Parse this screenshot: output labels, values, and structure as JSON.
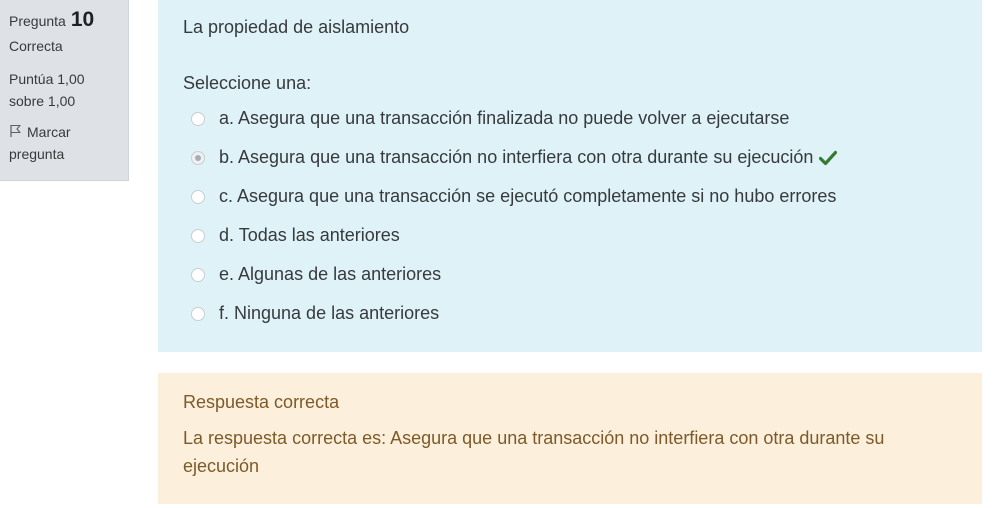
{
  "info": {
    "question_label": "Pregunta",
    "question_number": "10",
    "state": "Correcta",
    "grade_line1": "Puntúa 1,00",
    "grade_line2": "sobre 1,00",
    "flag_line1": "Marcar",
    "flag_line2": "pregunta",
    "flag_icon": "flag-icon"
  },
  "question": {
    "text": "La propiedad de aislamiento",
    "prompt": "Seleccione una:",
    "options": [
      {
        "label": "a. Asegura que una transacción finalizada no puede volver a ejecutarse",
        "selected": false
      },
      {
        "label": "b. Asegura que una transacción no interfiera con otra durante su ejecución",
        "selected": true,
        "correct_icon": "check-icon"
      },
      {
        "label": "c. Asegura que una transacción se ejecutó completamente si no hubo errores",
        "selected": false
      },
      {
        "label": "d. Todas las anteriores",
        "selected": false
      },
      {
        "label": "e. Algunas de las anteriores",
        "selected": false
      },
      {
        "label": "f. Ninguna de las anteriores",
        "selected": false
      }
    ]
  },
  "feedback": {
    "title": "Respuesta correcta",
    "right_answer": "La respuesta correcta es: Asegura que una transacción no interfiera con otra durante su ejecución"
  },
  "colors": {
    "info_bg": "#dee2e6",
    "question_bg": "#def2f8",
    "feedback_bg": "#fcefdc",
    "feedback_text": "#7d5a29",
    "correct_check": "#357a32"
  }
}
